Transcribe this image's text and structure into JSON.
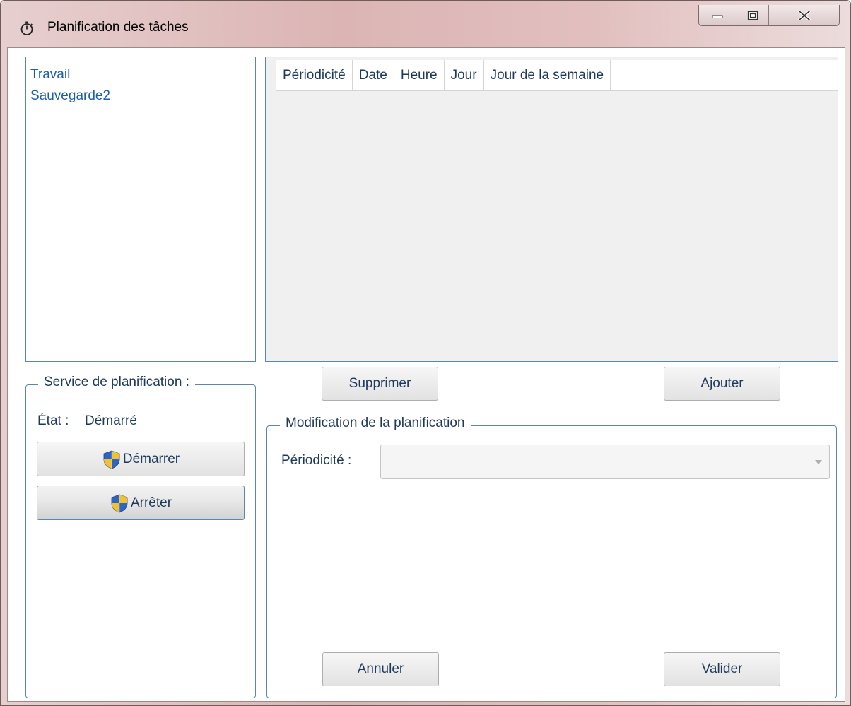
{
  "window": {
    "title": "Planification des tâches",
    "icon": "stopwatch-icon",
    "controls": [
      "minimize-icon",
      "maximize-icon",
      "close-icon"
    ]
  },
  "task_list": {
    "items": [
      {
        "label": "Travail"
      },
      {
        "label": "Sauvegarde2"
      }
    ]
  },
  "schedule_grid": {
    "columns": [
      "Périodicité",
      "Date",
      "Heure",
      "Jour",
      "Jour de la semaine"
    ],
    "rows": []
  },
  "grid_actions": {
    "delete_label": "Supprimer",
    "add_label": "Ajouter"
  },
  "service": {
    "group_title": "Service de planification :",
    "state_label": "État :",
    "state_value": "Démarré",
    "start_label": "Démarrer",
    "stop_label": "Arrêter",
    "shield_icon": "uac-shield-icon"
  },
  "edit": {
    "group_title": "Modification de la planification",
    "periodicity_label": "Périodicité :",
    "periodicity_value": "",
    "cancel_label": "Annuler",
    "validate_label": "Valider"
  },
  "colors": {
    "title_gradient_start": "#e7cfcf",
    "title_gradient_mid": "#dcb4b4",
    "border_blue": "#5b86b3",
    "text_blue": "#1e395b",
    "link_blue": "#1e5ea8",
    "grid_background": "#f0f0f0"
  }
}
